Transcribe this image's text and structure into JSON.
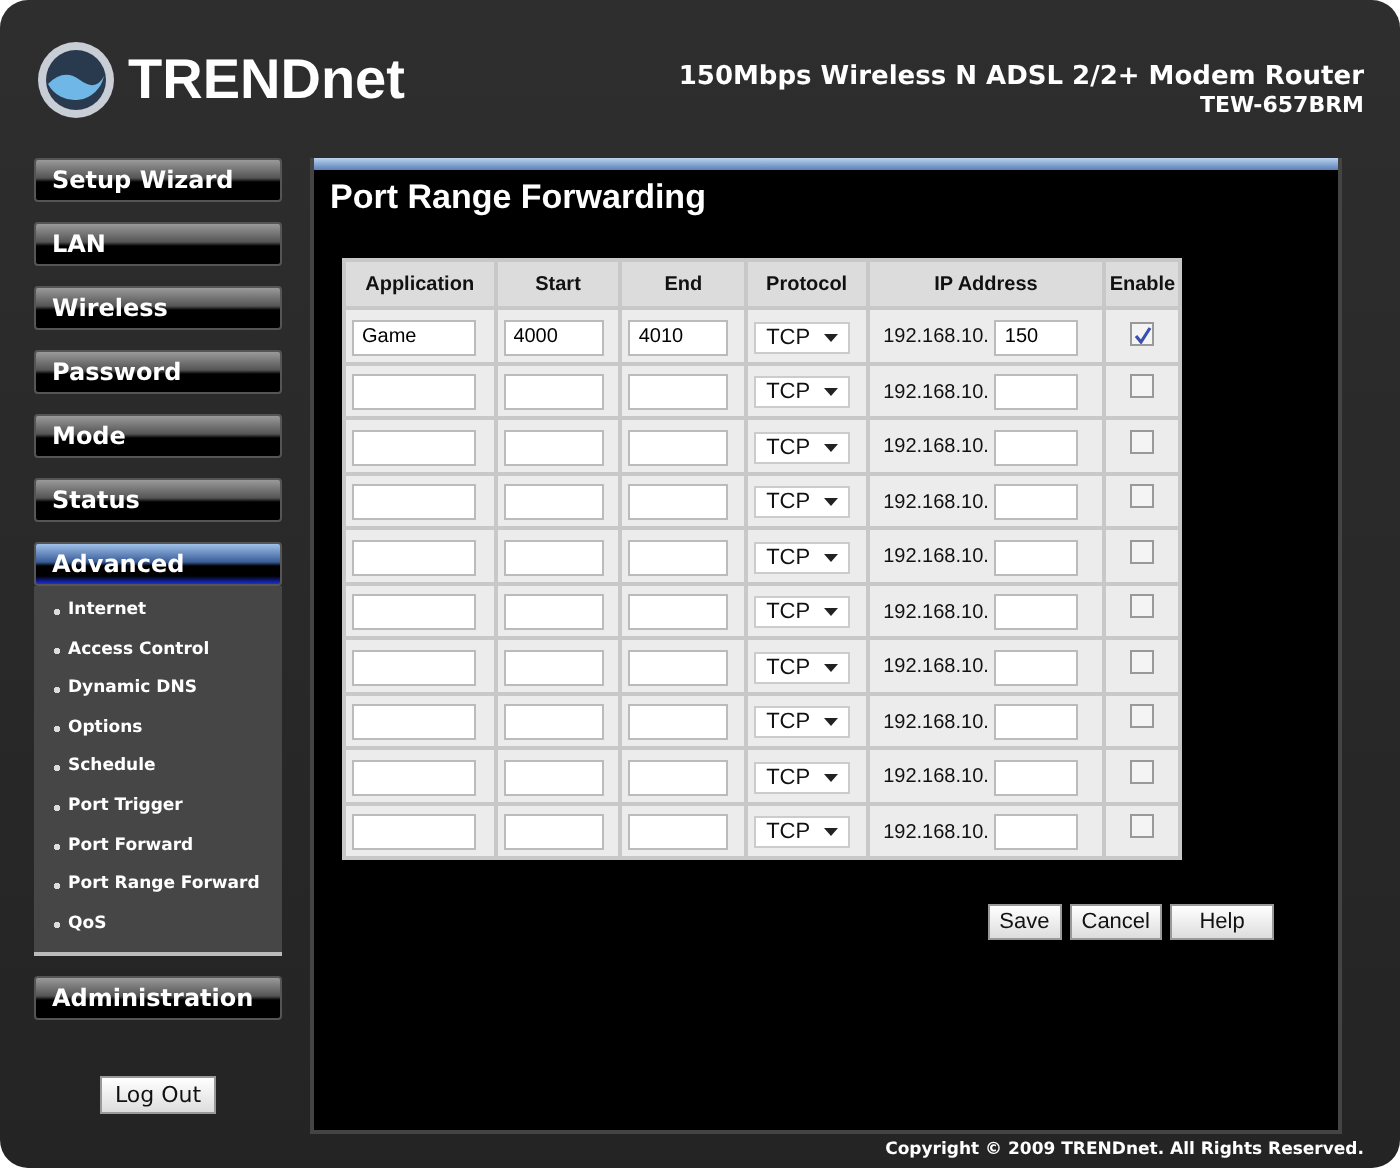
{
  "header": {
    "brand": "TRENDnet",
    "product": "150Mbps Wireless N ADSL 2/2+ Modem Router",
    "model": "TEW-657BRM"
  },
  "sidebar": {
    "items": [
      {
        "label": "Setup Wizard",
        "selected": false
      },
      {
        "label": "LAN",
        "selected": false
      },
      {
        "label": "Wireless",
        "selected": false
      },
      {
        "label": "Password",
        "selected": false
      },
      {
        "label": "Mode",
        "selected": false
      },
      {
        "label": "Status",
        "selected": false
      },
      {
        "label": "Advanced",
        "selected": true,
        "children": [
          {
            "label": "Internet"
          },
          {
            "label": "Access Control"
          },
          {
            "label": "Dynamic DNS"
          },
          {
            "label": "Options"
          },
          {
            "label": "Schedule"
          },
          {
            "label": "Port Trigger"
          },
          {
            "label": "Port Forward"
          },
          {
            "label": "Port Range Forward"
          },
          {
            "label": "QoS"
          }
        ]
      },
      {
        "label": "Administration",
        "selected": false
      }
    ],
    "logout": "Log Out"
  },
  "page_title": "Port Range Forwarding",
  "table": {
    "columns": [
      "Application",
      "Start",
      "End",
      "Protocol",
      "IP Address",
      "Enable"
    ],
    "rows": [
      {
        "application": "Game",
        "start": "4000",
        "end": "4010",
        "protocol": "TCP",
        "ip_prefix": "192.168.10.",
        "ip_suffix": "150",
        "enabled": true
      },
      {
        "protocol": "TCP",
        "ip_prefix": "192.168.10.",
        "enabled": false
      },
      {
        "protocol": "TCP",
        "ip_prefix": "192.168.10.",
        "enabled": false
      },
      {
        "protocol": "TCP",
        "ip_prefix": "192.168.10.",
        "enabled": false
      },
      {
        "protocol": "TCP",
        "ip_prefix": "192.168.10.",
        "enabled": false
      },
      {
        "protocol": "TCP",
        "ip_prefix": "192.168.10.",
        "enabled": false
      },
      {
        "protocol": "TCP",
        "ip_prefix": "192.168.10.",
        "enabled": false
      },
      {
        "protocol": "TCP",
        "ip_prefix": "192.168.10.",
        "enabled": false
      },
      {
        "protocol": "TCP",
        "ip_prefix": "192.168.10.",
        "enabled": false
      },
      {
        "protocol": "TCP",
        "ip_prefix": "192.168.10.",
        "enabled": false
      }
    ]
  },
  "buttons": [
    "Save",
    "Cancel",
    "Help"
  ],
  "footer": "Copyright © 2009 TRENDnet. All Rights Reserved."
}
